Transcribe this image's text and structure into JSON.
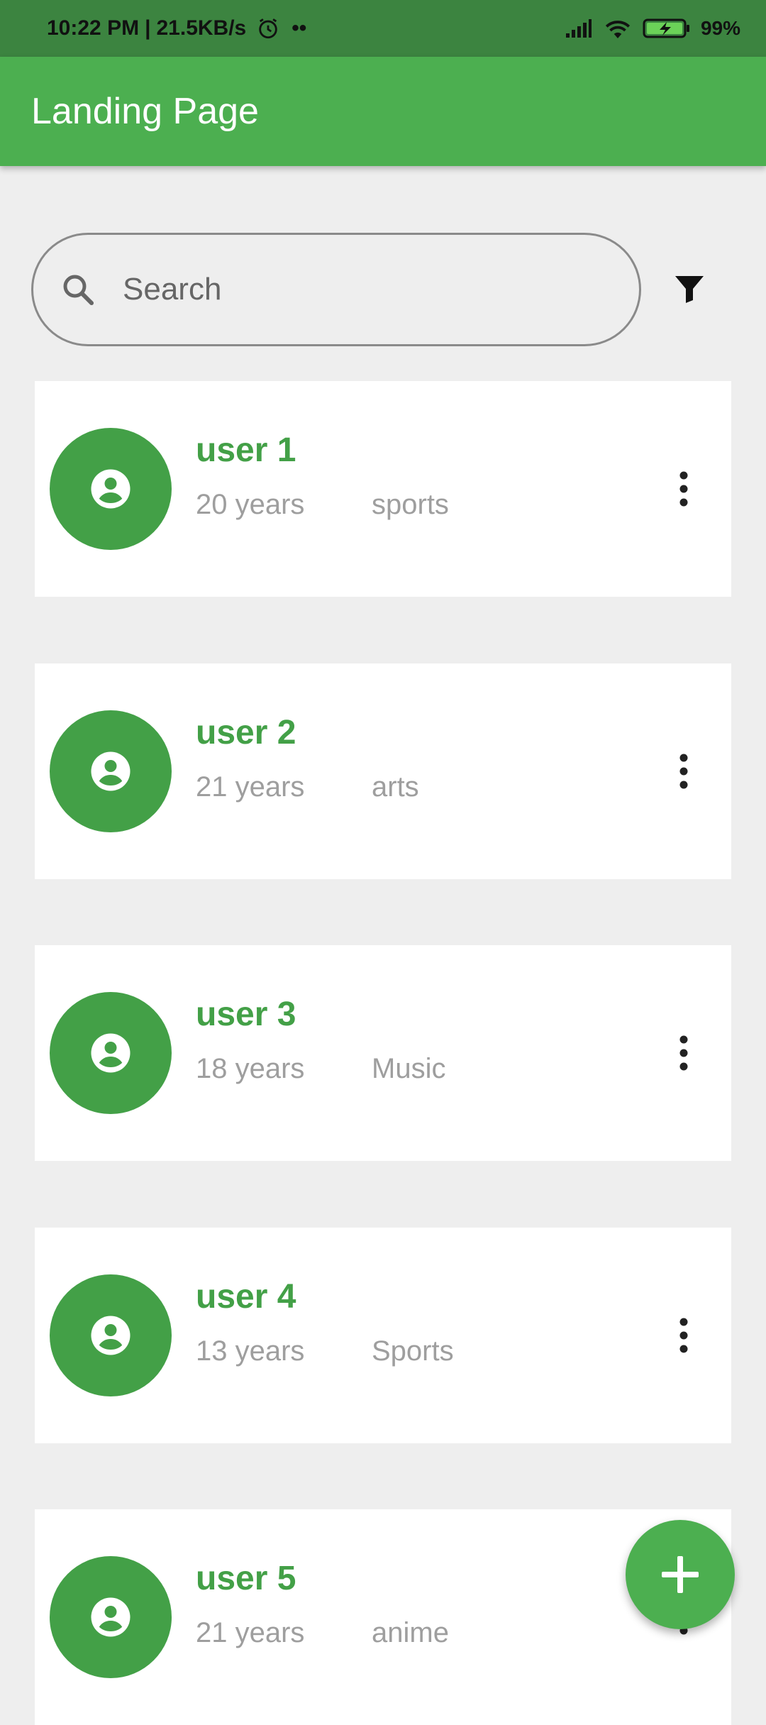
{
  "status_bar": {
    "time": "10:22 PM",
    "speed": "21.5KB/s",
    "battery": "99%",
    "icons": [
      "alarm-icon",
      "signal-icon",
      "wifi-icon",
      "battery-charging-icon"
    ]
  },
  "app_bar": {
    "title": "Landing Page"
  },
  "search": {
    "placeholder": "Search",
    "value": ""
  },
  "users": [
    {
      "name": "user 1",
      "age": "20 years",
      "interest": "sports"
    },
    {
      "name": "user 2",
      "age": "21 years",
      "interest": "arts"
    },
    {
      "name": "user 3",
      "age": "18 years",
      "interest": "Music"
    },
    {
      "name": "user 4",
      "age": "13 years",
      "interest": "Sports"
    },
    {
      "name": "user 5",
      "age": "21 years",
      "interest": "anime"
    }
  ],
  "colors": {
    "primary": "#4caf50",
    "status_bar": "#3c8440",
    "avatar": "#43a047",
    "name_text": "#43a047",
    "secondary_text": "#9e9e9e",
    "background": "#eeeeee"
  }
}
